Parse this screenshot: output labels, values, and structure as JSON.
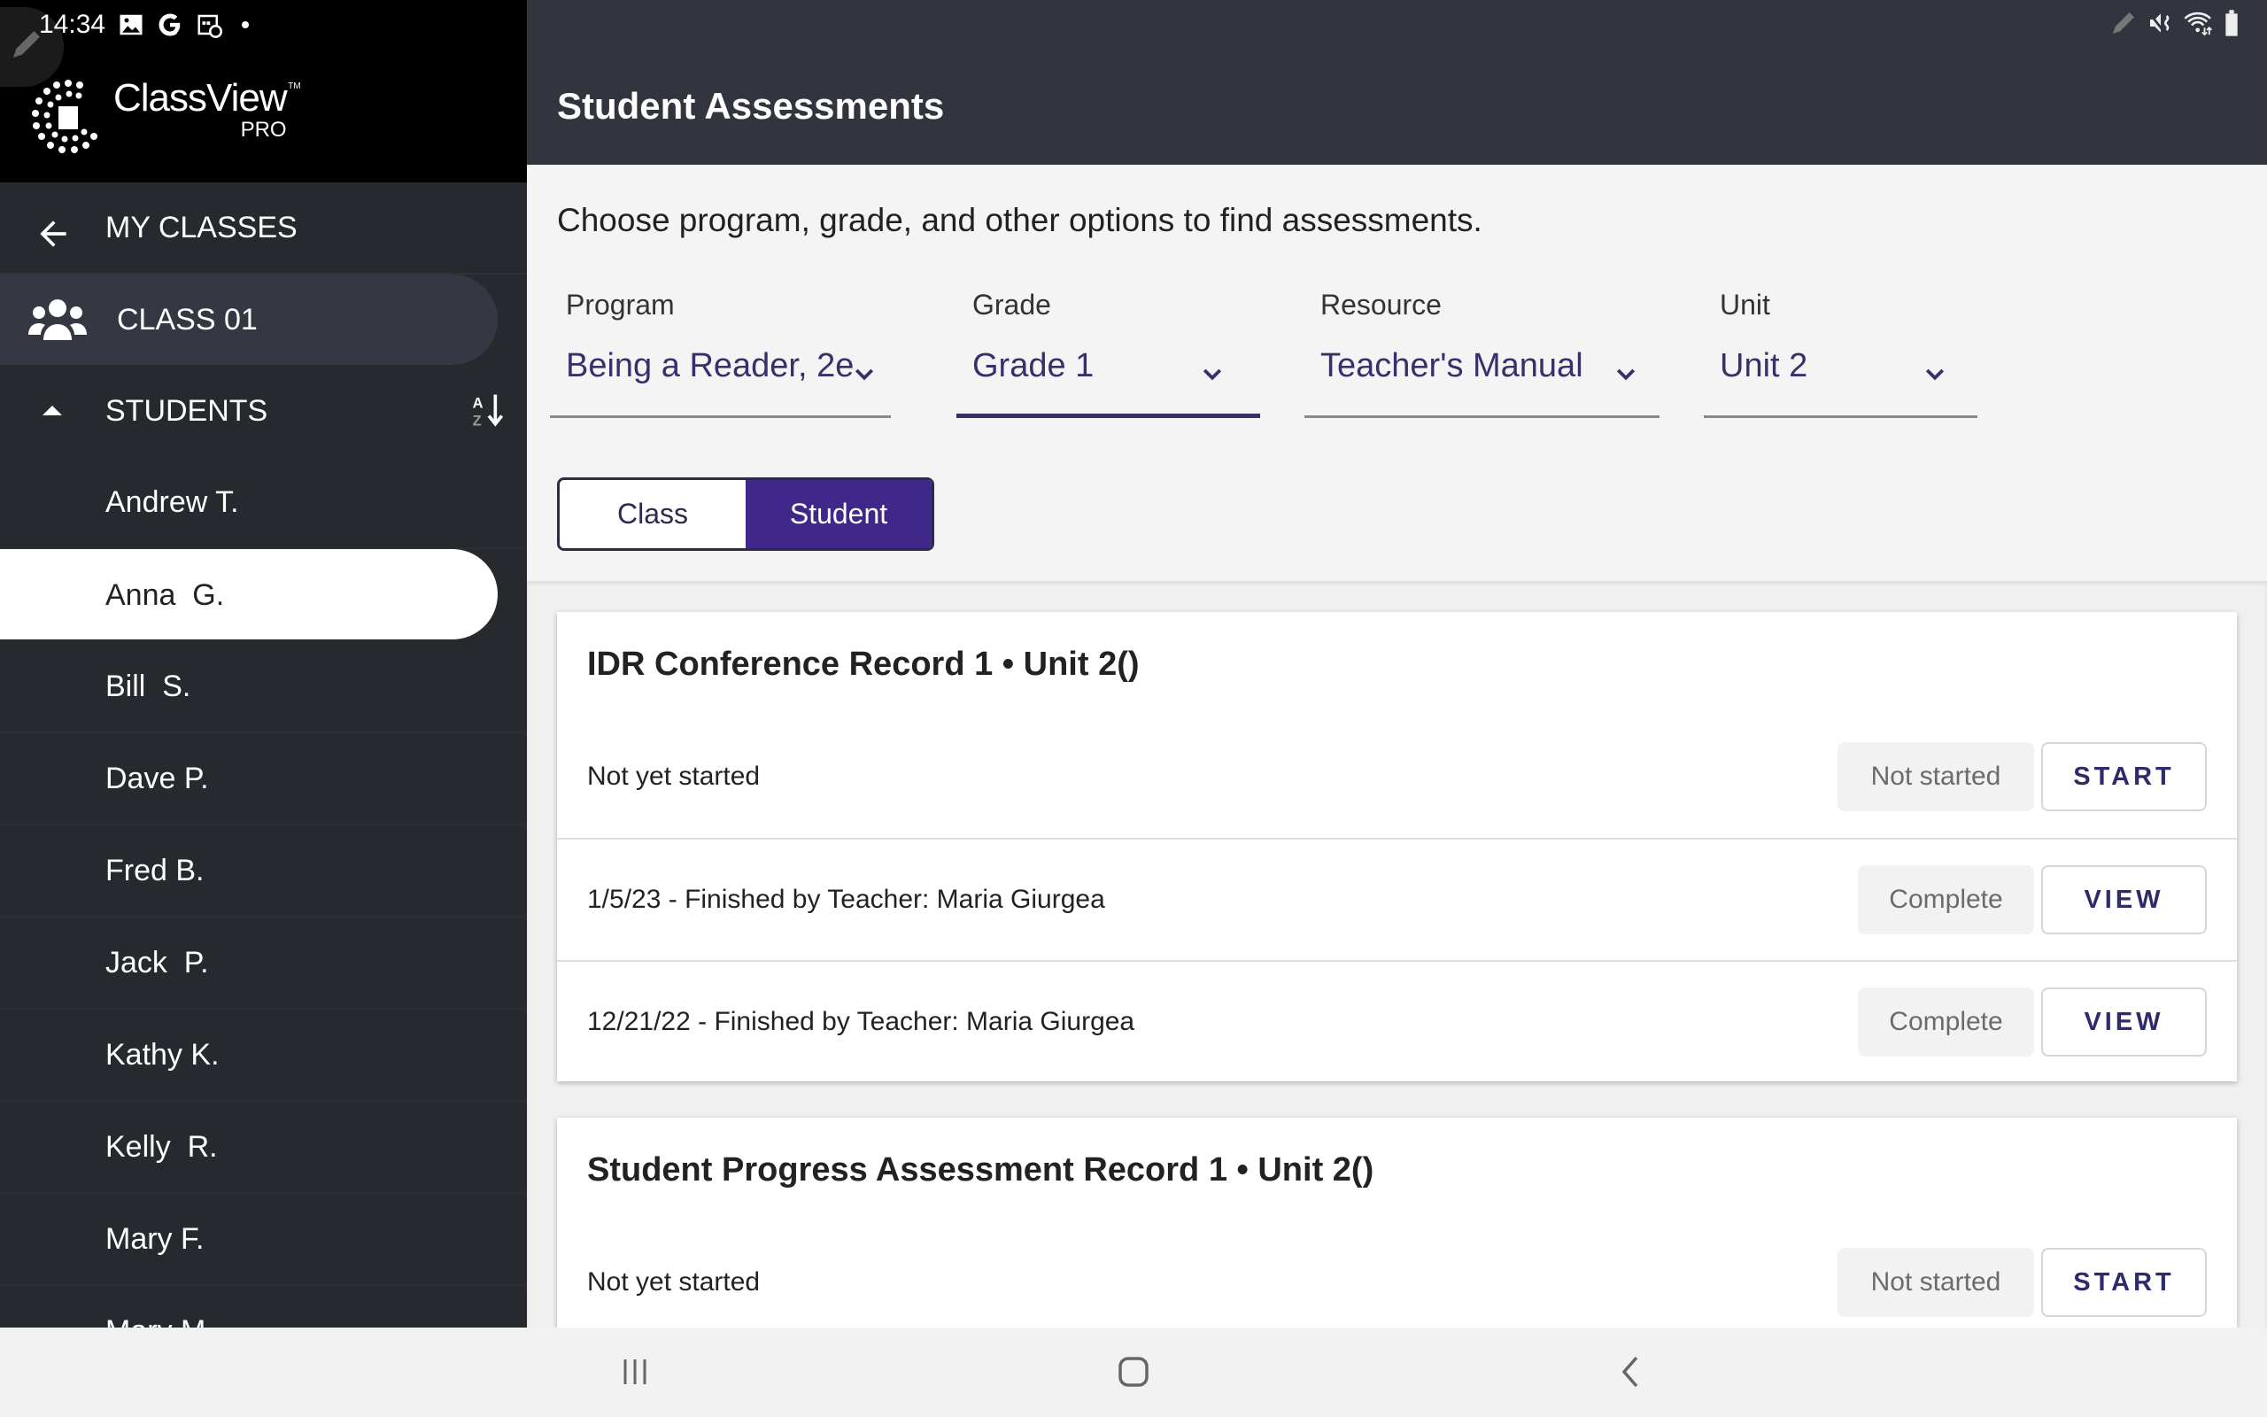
{
  "status_bar": {
    "time": "14:34",
    "left_icons": [
      "gallery-icon",
      "google-icon",
      "calendar-clock-icon",
      "dot-icon"
    ],
    "right_icons": [
      "pen-icon",
      "mute-icon",
      "wifi-icon",
      "battery-icon"
    ]
  },
  "app": {
    "logo_name": "ClassView",
    "logo_tm": "TM",
    "logo_sub": "PRO"
  },
  "sidebar": {
    "back_label": "MY CLASSES",
    "class_label": "CLASS 01",
    "students_header": "STUDENTS",
    "students": [
      {
        "name": "Andrew T.",
        "selected": false
      },
      {
        "name": "Anna  G.",
        "selected": true
      },
      {
        "name": "Bill  S.",
        "selected": false
      },
      {
        "name": "Dave P.",
        "selected": false
      },
      {
        "name": "Fred B.",
        "selected": false
      },
      {
        "name": "Jack  P.",
        "selected": false
      },
      {
        "name": "Kathy K.",
        "selected": false
      },
      {
        "name": "Kelly  R.",
        "selected": false
      },
      {
        "name": "Mary F.",
        "selected": false
      },
      {
        "name": "Mary M.",
        "selected": false
      }
    ]
  },
  "header": {
    "title": "Student Assessments"
  },
  "main": {
    "intro": "Choose program, grade, and other options to find assessments.",
    "filters": {
      "program": {
        "label": "Program",
        "value": "Being a Reader, 2e"
      },
      "grade": {
        "label": "Grade",
        "value": "Grade 1"
      },
      "resource": {
        "label": "Resource",
        "value": "Teacher's Manual"
      },
      "unit": {
        "label": "Unit",
        "value": "Unit 2"
      }
    },
    "view_toggle": {
      "options": [
        "Class",
        "Student"
      ],
      "selected": "Student"
    },
    "assessments": [
      {
        "title": "IDR Conference Record 1 • Unit 2()",
        "rows": [
          {
            "text": "Not yet started",
            "status": "Not started",
            "action": "START"
          },
          {
            "text": "1/5/23 - Finished by Teacher: Maria Giurgea",
            "status": "Complete",
            "action": "VIEW"
          },
          {
            "text": "12/21/22 - Finished by Teacher: Maria Giurgea",
            "status": "Complete",
            "action": "VIEW"
          }
        ]
      },
      {
        "title": "Student Progress Assessment Record 1 • Unit 2()",
        "rows": [
          {
            "text": "Not yet started",
            "status": "Not started",
            "action": "START"
          }
        ]
      }
    ]
  },
  "colors": {
    "accent": "#40288a",
    "accent_text": "#3a2f6b",
    "sidebar_bg": "#26292e",
    "header_bg": "#32353e"
  },
  "android_nav": {
    "buttons": [
      "recent-apps-icon",
      "home-icon",
      "back-icon"
    ]
  }
}
